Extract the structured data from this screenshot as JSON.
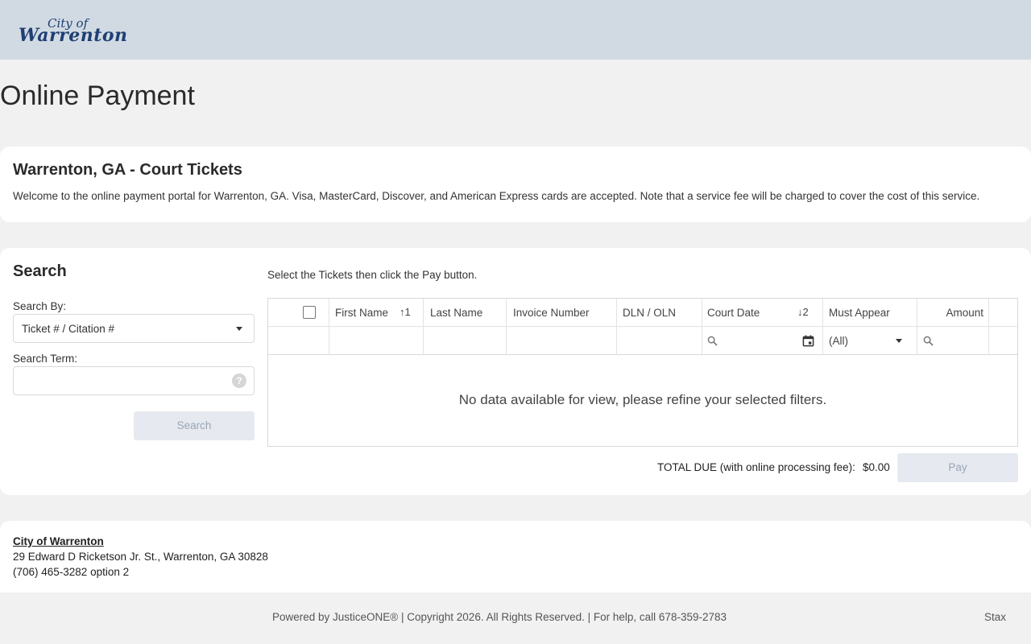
{
  "header": {
    "logo_small": "City of",
    "logo_big": "Warrenton"
  },
  "page_title": "Online Payment",
  "intro": {
    "title": "Warrenton, GA - Court Tickets",
    "text": "Welcome to the online payment portal for Warrenton, GA. Visa, MasterCard, Discover, and American Express cards are accepted. Note that a service fee will be charged to cover the cost of this service."
  },
  "search": {
    "title": "Search",
    "by_label": "Search By:",
    "by_value": "Ticket # / Citation #",
    "term_label": "Search Term:",
    "term_value": "",
    "help_glyph": "?",
    "button_label": "Search"
  },
  "grid": {
    "instructions": "Select the Tickets then click the Pay button.",
    "columns": [
      {
        "label": "First Name",
        "sort": "↑1"
      },
      {
        "label": "Last Name",
        "sort": ""
      },
      {
        "label": "Invoice Number",
        "sort": ""
      },
      {
        "label": "DLN / OLN",
        "sort": ""
      },
      {
        "label": "Court Date",
        "sort": "↓2"
      },
      {
        "label": "Must Appear",
        "sort": ""
      },
      {
        "label": "Amount",
        "sort": ""
      }
    ],
    "must_appear_filter": "(All)",
    "empty_message": "No data available for view, please refine your selected filters."
  },
  "totals": {
    "label": "TOTAL DUE (with online processing fee):",
    "value": "$0.00",
    "pay_label": "Pay"
  },
  "address": {
    "name": "City of Warrenton",
    "street": "29 Edward D Ricketson Jr. St., Warrenton, GA 30828",
    "phone": "(706) 465-3282 option 2"
  },
  "footer": {
    "powered": "Powered by JusticeONE® | Copyright 2026. All Rights Reserved. | For help, call 678-359-2783",
    "stax": "Stax"
  },
  "colors": {
    "header_bg": "#d1dae3",
    "logo": "#1f3f73",
    "disabled_button": "#e6eaf0"
  }
}
